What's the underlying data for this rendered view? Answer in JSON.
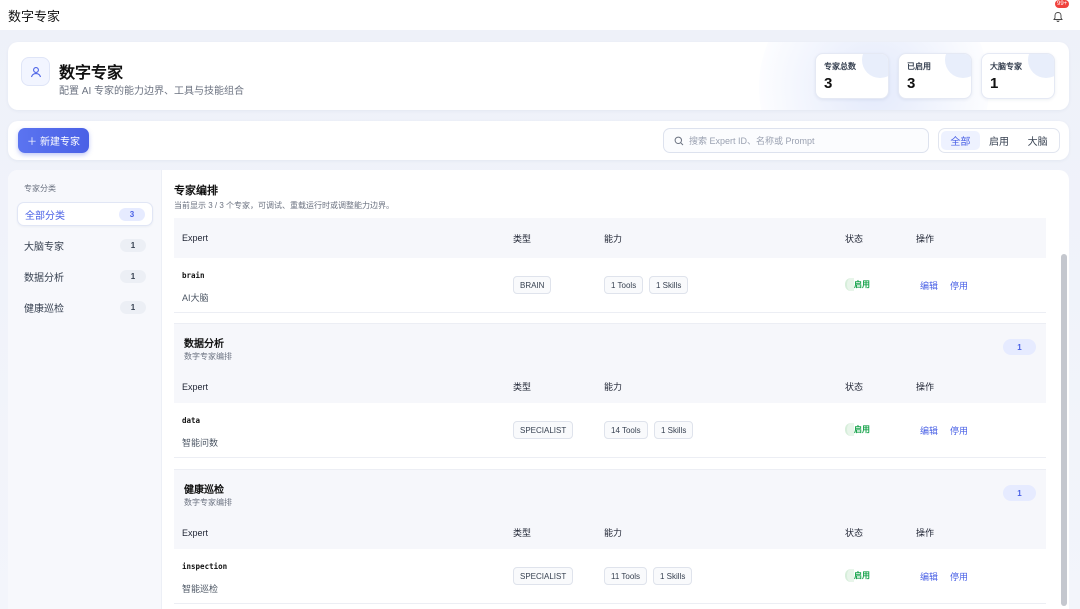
{
  "app": {
    "title": "数字专家",
    "notification_badge": "99+"
  },
  "header": {
    "title": "数字专家",
    "subtitle": "配置 AI 专家的能力边界、工具与技能组合",
    "stats": [
      {
        "label": "专家总数",
        "value": "3"
      },
      {
        "label": "已启用",
        "value": "3"
      },
      {
        "label": "大脑专家",
        "value": "1"
      }
    ]
  },
  "toolbar": {
    "new_button": "新建专家",
    "search_placeholder": "搜索 Expert ID、名称或 Prompt",
    "filters": [
      "全部",
      "启用",
      "大脑"
    ],
    "active_filter": "全部"
  },
  "sidebar": {
    "title": "专家分类",
    "items": [
      {
        "label": "全部分类",
        "count": "3",
        "active": true
      },
      {
        "label": "大脑专家",
        "count": "1"
      },
      {
        "label": "数据分析",
        "count": "1"
      },
      {
        "label": "健康巡检",
        "count": "1"
      }
    ]
  },
  "content": {
    "title": "专家编排",
    "subtitle": "当前显示 3 / 3 个专家，可调试、重载运行时或调整能力边界。",
    "columns": [
      "Expert",
      "类型",
      "能力",
      "状态",
      "操作"
    ],
    "groups": [
      {
        "rows": [
          {
            "id": "brain",
            "name": "AI大脑",
            "type": "BRAIN",
            "tools": "1 Tools",
            "skills": "1 Skills",
            "status": "启用",
            "edit": "编辑",
            "disable": "停用"
          }
        ]
      },
      {
        "title": "数据分析",
        "subtitle": "数字专家编排",
        "count": "1",
        "rows": [
          {
            "id": "data",
            "name": "智能问数",
            "type": "SPECIALIST",
            "tools": "14 Tools",
            "skills": "1 Skills",
            "status": "启用",
            "edit": "编辑",
            "disable": "停用"
          }
        ]
      },
      {
        "title": "健康巡检",
        "subtitle": "数字专家编排",
        "count": "1",
        "rows": [
          {
            "id": "inspection",
            "name": "智能巡检",
            "type": "SPECIALIST",
            "tools": "11 Tools",
            "skills": "1 Skills",
            "status": "启用",
            "edit": "编辑",
            "disable": "停用"
          }
        ]
      }
    ]
  },
  "colors": {
    "accent": "#4a61e6",
    "success": "#16a34a",
    "badge": "#f0413c"
  }
}
